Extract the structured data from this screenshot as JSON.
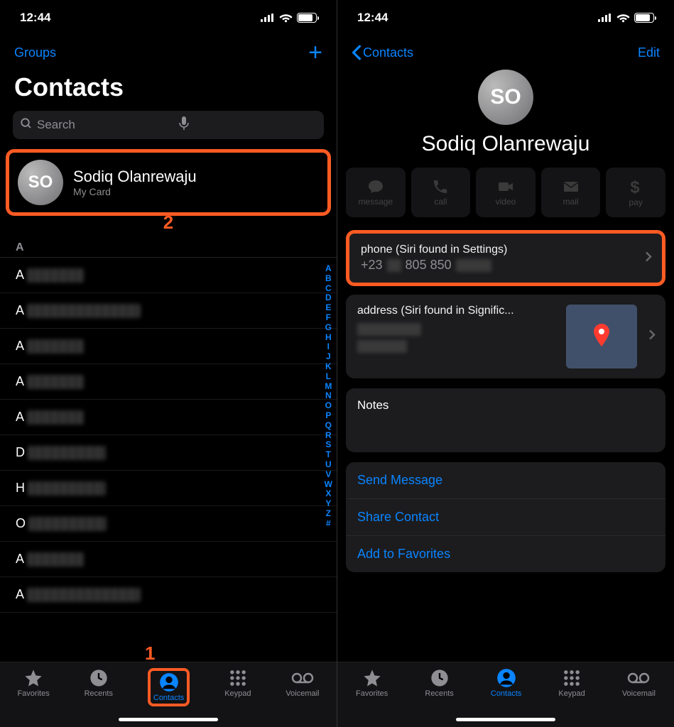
{
  "status": {
    "time": "12:44"
  },
  "left": {
    "nav": {
      "groups": "Groups"
    },
    "title": "Contacts",
    "search_placeholder": "Search",
    "mycard": {
      "initials": "SO",
      "name": "Sodiq Olanrewaju",
      "sub": "My Card"
    },
    "annotation2": "2",
    "annotation1": "1",
    "section_a": "A",
    "rows_prefix": [
      "A",
      "A",
      "A",
      "A",
      "A",
      "D",
      "H",
      "O",
      "A",
      "A"
    ],
    "index": [
      "A",
      "B",
      "C",
      "D",
      "E",
      "F",
      "G",
      "H",
      "I",
      "J",
      "K",
      "L",
      "M",
      "N",
      "O",
      "P",
      "Q",
      "R",
      "S",
      "T",
      "U",
      "V",
      "W",
      "X",
      "Y",
      "Z",
      "#"
    ]
  },
  "right": {
    "nav": {
      "back": "Contacts",
      "edit": "Edit"
    },
    "avatar_initials": "SO",
    "name": "Sodiq Olanrewaju",
    "actions": {
      "message": "message",
      "call": "call",
      "video": "video",
      "mail": "mail",
      "pay": "pay"
    },
    "phone_label": "phone (Siri found in Settings)",
    "phone_value_prefix": "+23",
    "phone_value_mid": " 805 850 ",
    "address_label": "address (Siri found in Signific...",
    "notes_label": "Notes",
    "links": {
      "send": "Send Message",
      "share": "Share Contact",
      "fav": "Add to Favorites"
    }
  },
  "tabs": {
    "favorites": "Favorites",
    "recents": "Recents",
    "contacts": "Contacts",
    "keypad": "Keypad",
    "voicemail": "Voicemail"
  }
}
